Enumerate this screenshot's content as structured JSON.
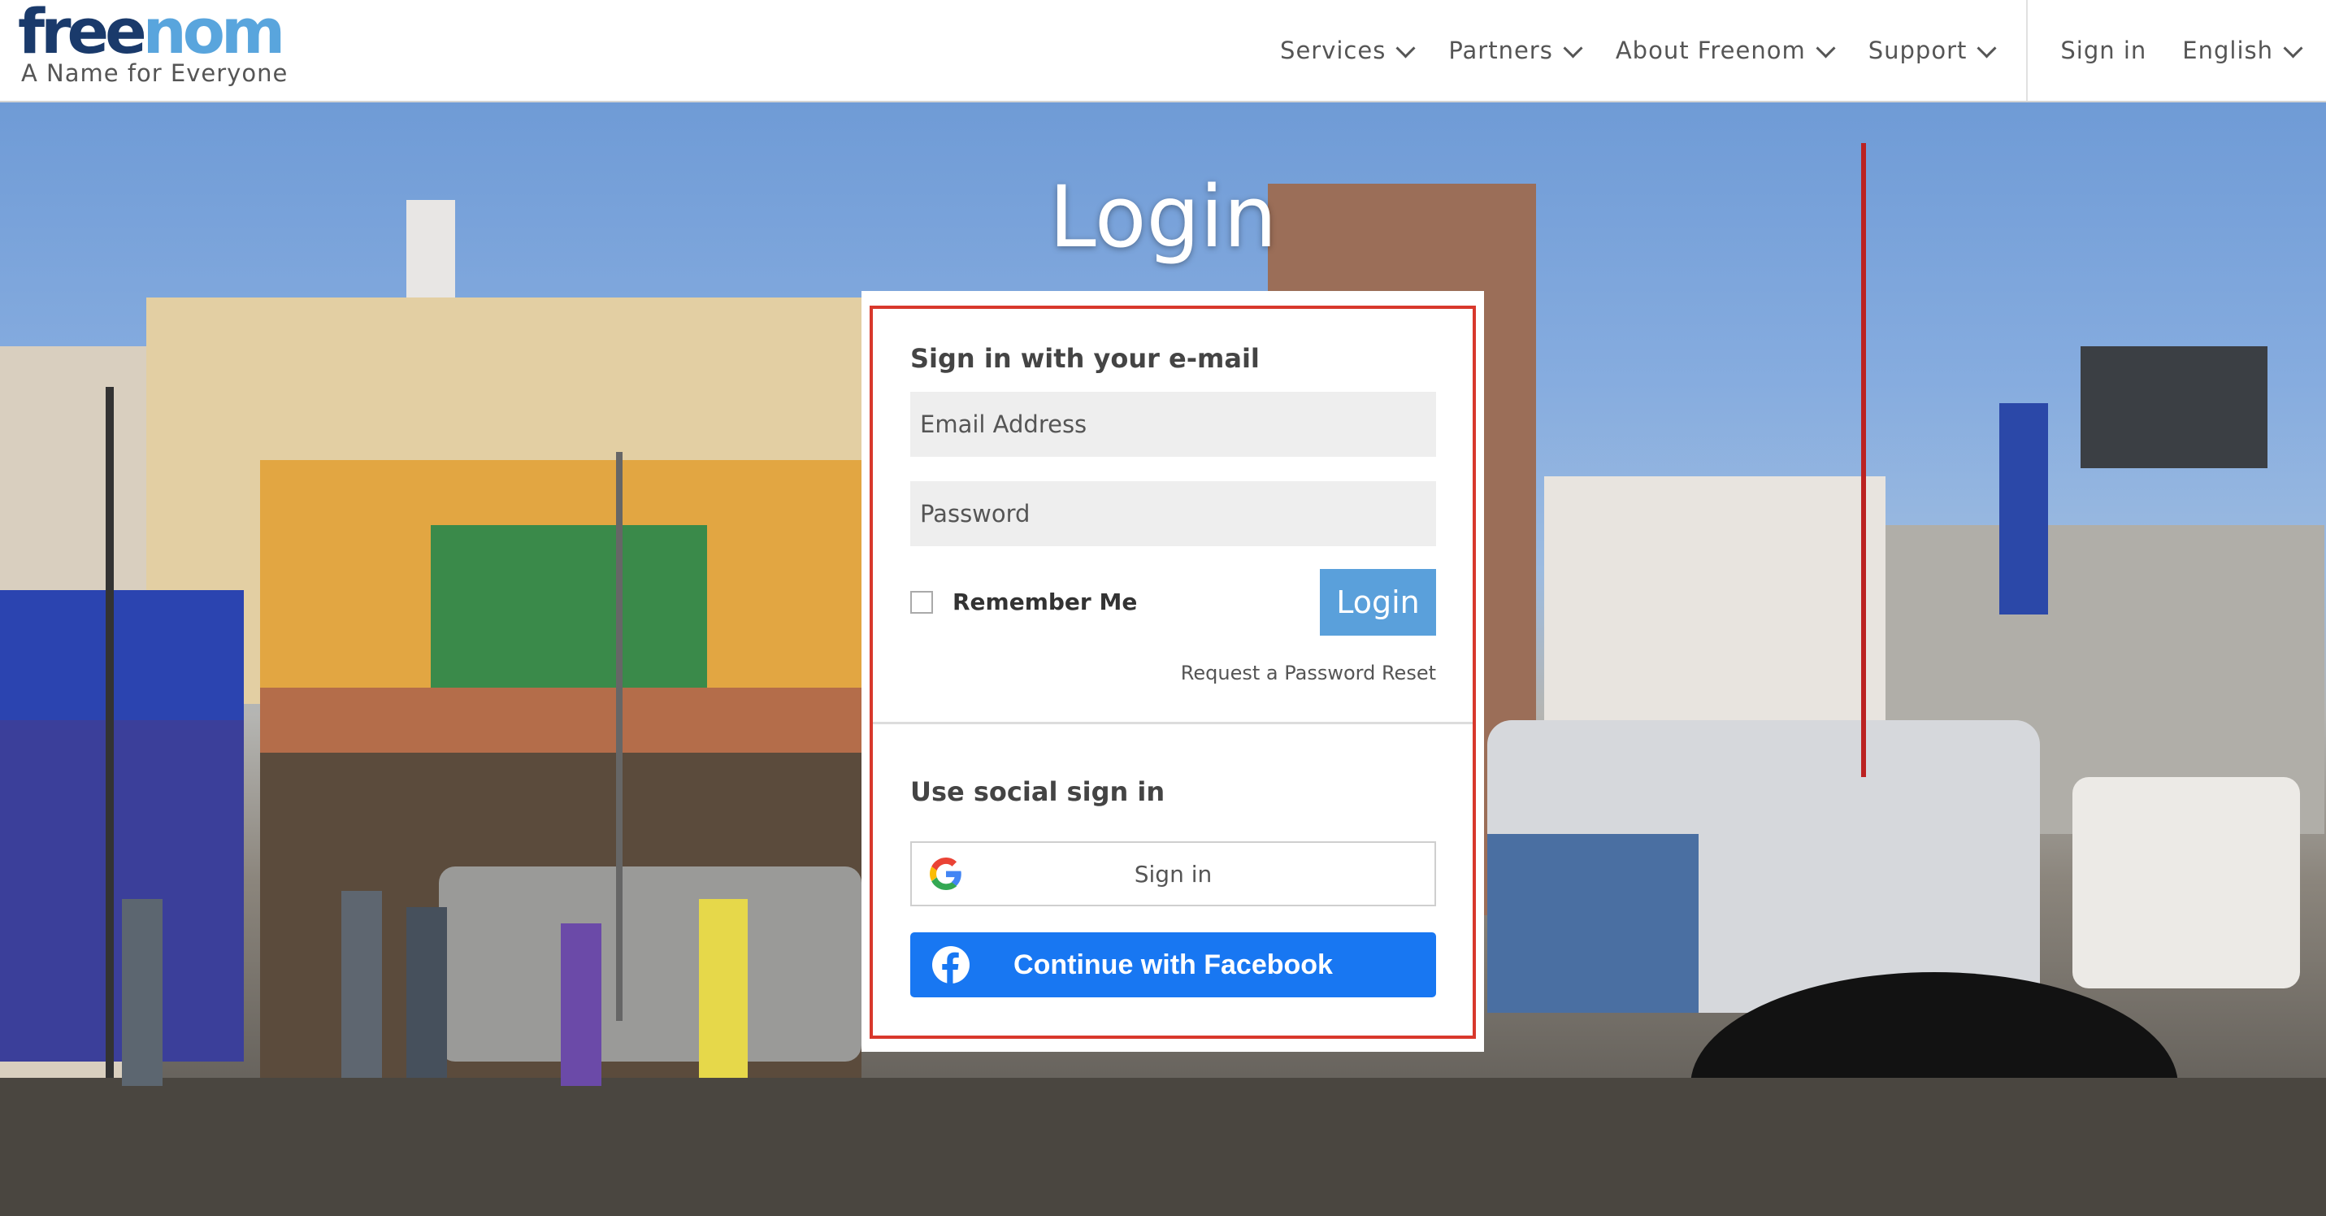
{
  "header": {
    "logo_main_a": "free",
    "logo_main_b": "nom",
    "logo_tagline": "A Name for Everyone",
    "nav": [
      {
        "label": "Services"
      },
      {
        "label": "Partners"
      },
      {
        "label": "About Freenom"
      },
      {
        "label": "Support"
      }
    ],
    "sign_in": "Sign in",
    "language": "English"
  },
  "hero": {
    "title": "Login"
  },
  "login_form": {
    "email_heading": "Sign in with your e-mail",
    "email_placeholder": "Email Address",
    "password_placeholder": "Password",
    "remember_label": "Remember Me",
    "remember_checked": false,
    "login_button": "Login",
    "reset_link": "Request a Password Reset",
    "social_heading": "Use social sign in",
    "google_button": "Sign in",
    "facebook_button": "Continue with Facebook"
  },
  "colors": {
    "logo_dark": "#1a3a6b",
    "logo_accent": "#59a5dd",
    "login_button": "#5aa0db",
    "facebook": "#1877f2",
    "highlight_outline": "#d8382c"
  },
  "icons": [
    "chevron-down-icon",
    "google-icon",
    "facebook-icon"
  ]
}
